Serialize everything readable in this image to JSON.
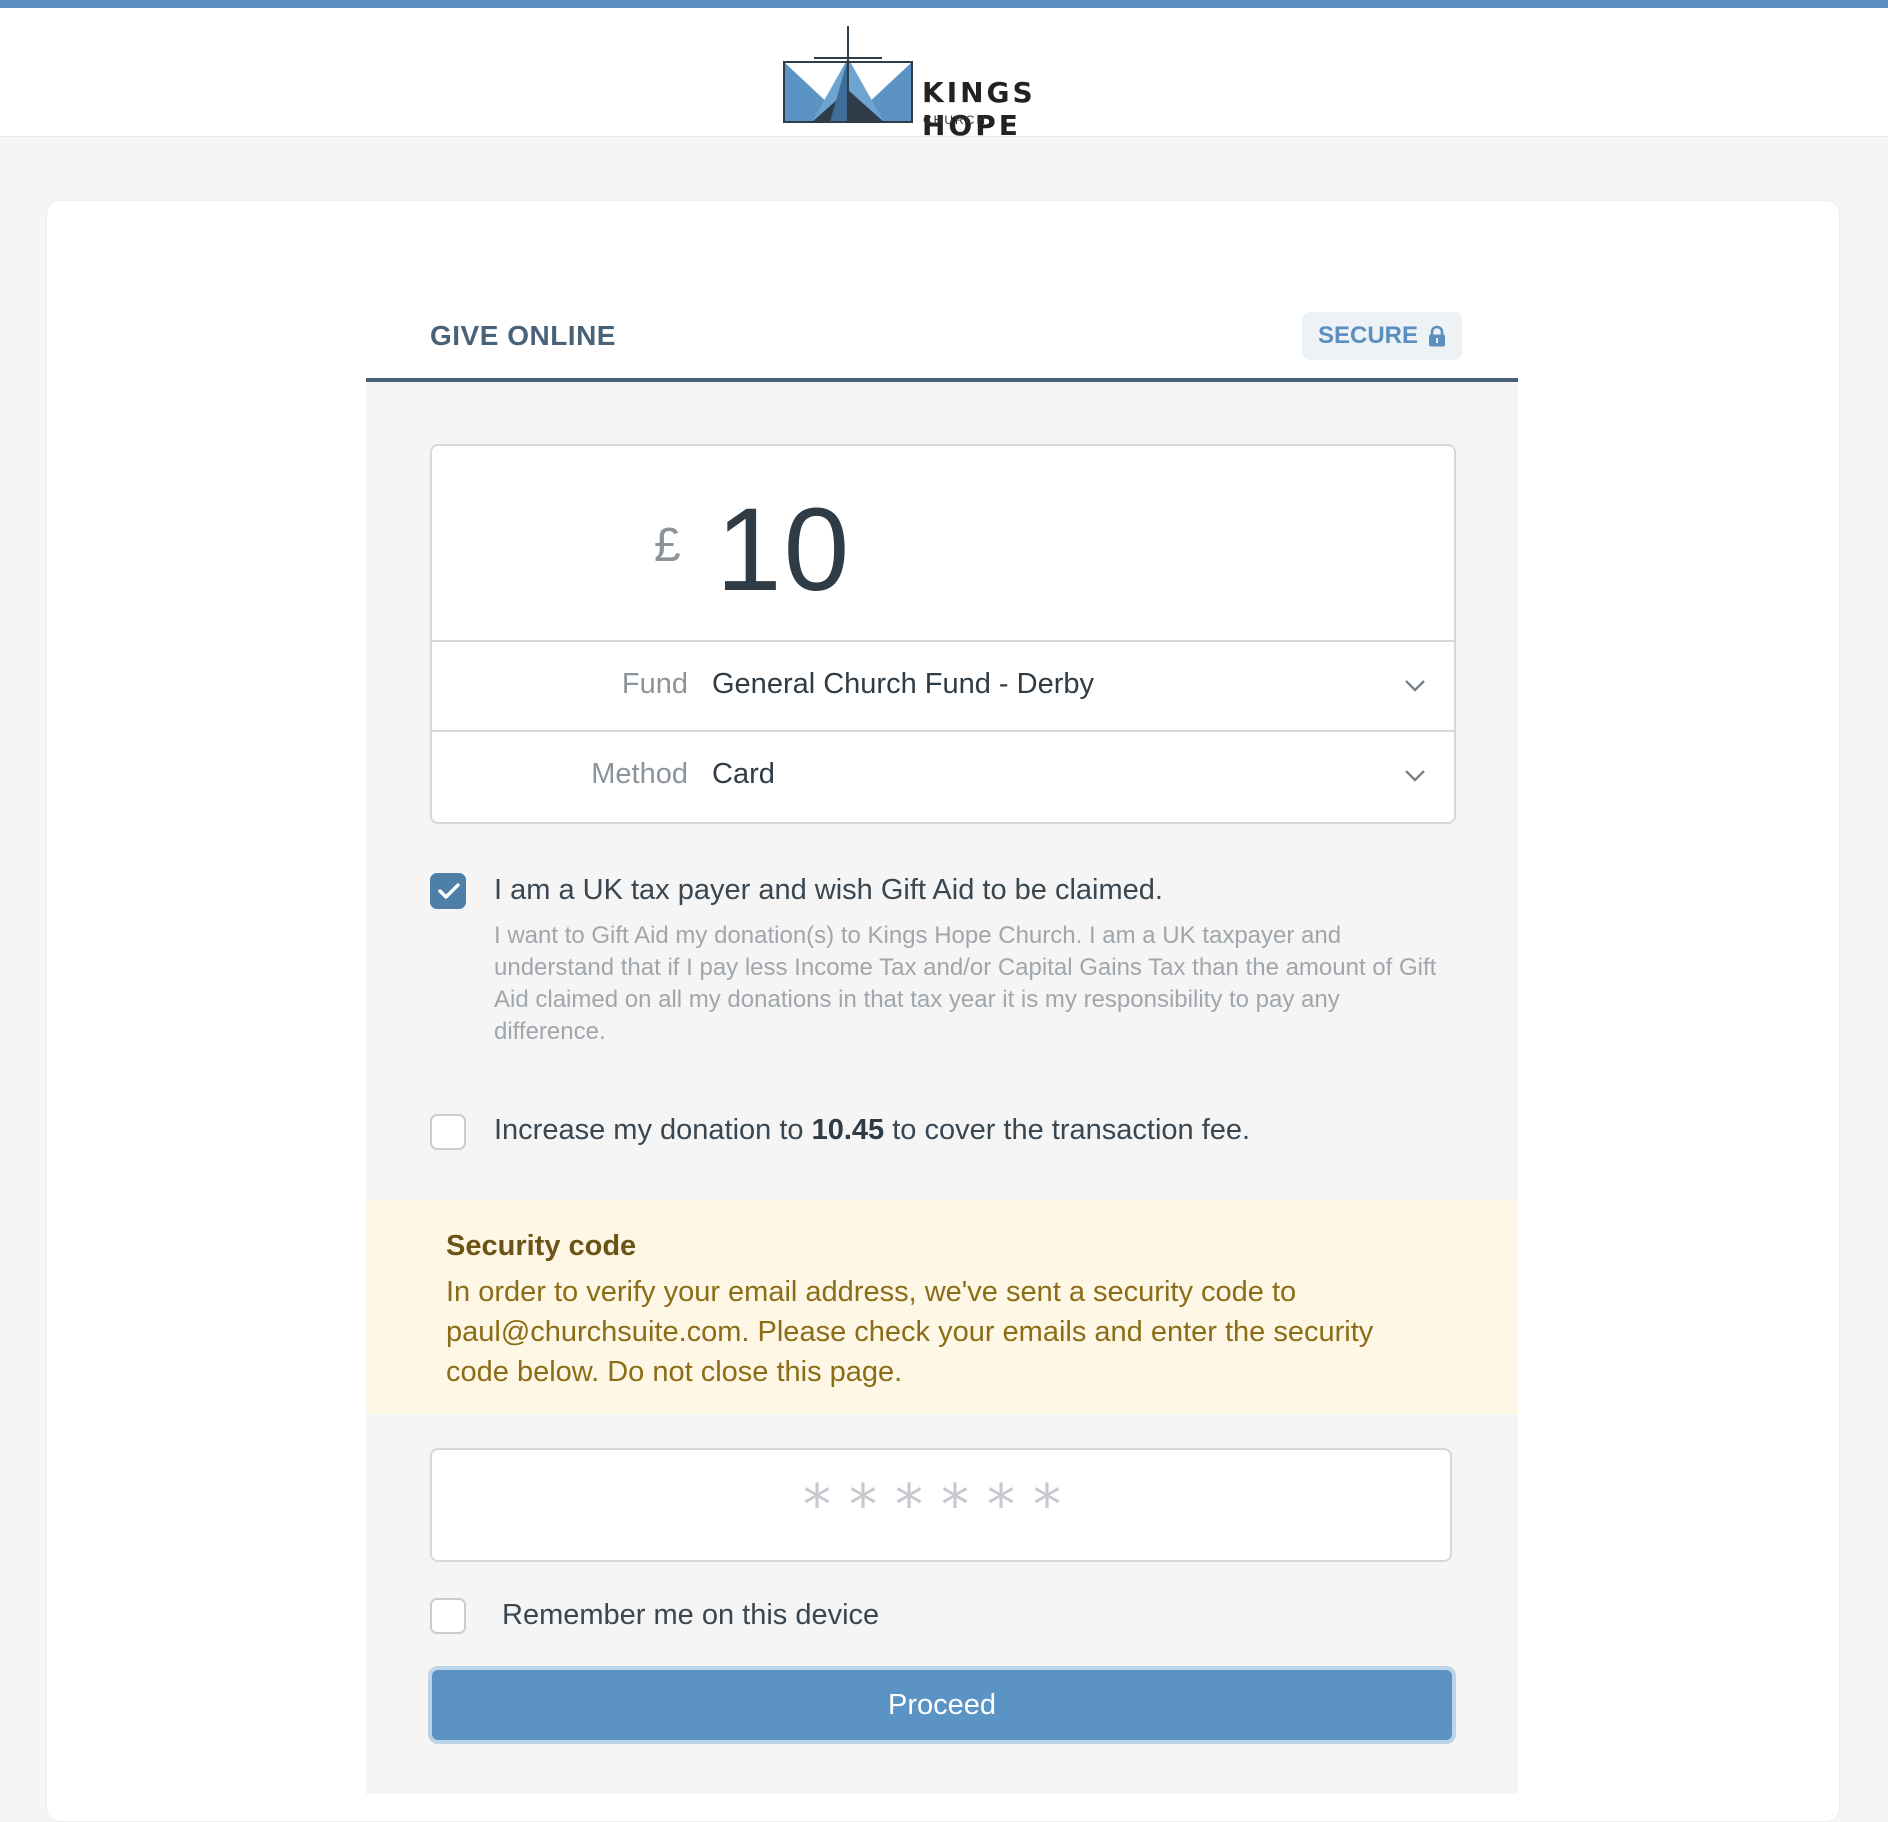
{
  "brand": {
    "name": "KINGS HOPE",
    "sub": "CHURCH",
    "accent": "#5b8fbf"
  },
  "form": {
    "title": "GIVE ONLINE",
    "secure_label": "SECURE",
    "secure_icon": "lock-icon"
  },
  "amount": {
    "currency": "£",
    "value": "10"
  },
  "fund": {
    "label": "Fund",
    "value": "General Church Fund - Derby"
  },
  "method": {
    "label": "Method",
    "value": "Card"
  },
  "gift_aid": {
    "checked": true,
    "label": "I am a UK tax payer and wish Gift Aid to be claimed.",
    "description": "I want to Gift Aid my donation(s) to Kings Hope Church. I am a UK taxpayer and understand that if I pay less Income Tax and/or Capital Gains Tax than the amount of Gift Aid claimed on all my donations in that tax year it is my responsibility to pay any difference."
  },
  "fee": {
    "checked": false,
    "prefix": "Increase my donation to ",
    "amount": "10.45",
    "suffix": " to cover the transaction fee."
  },
  "security_notice": {
    "title": "Security code",
    "body": "In order to verify your email address, we've sent a security code to paul@churchsuite.com. Please check your emails and enter the security code below. Do not close this page."
  },
  "security_code": {
    "value": "",
    "placeholder": "******"
  },
  "remember": {
    "checked": false,
    "label": "Remember me on this device"
  },
  "proceed_label": "Proceed"
}
